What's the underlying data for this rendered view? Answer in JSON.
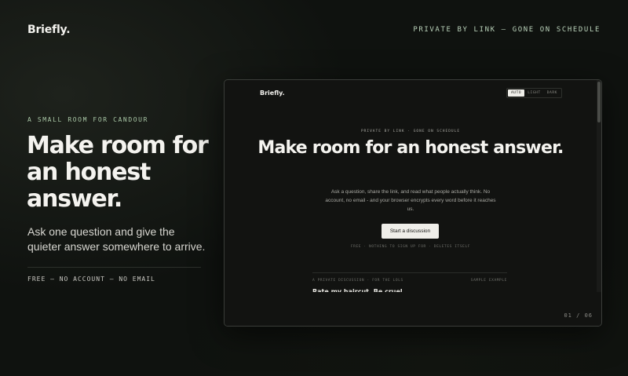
{
  "header": {
    "brand": "Briefly.",
    "tagline": "PRIVATE BY LINK — GONE ON SCHEDULE"
  },
  "hero": {
    "eyebrow": "A SMALL ROOM FOR CANDOUR",
    "title": "Make room for an honest answer.",
    "subtitle": "Ask one question and give the quieter answer somewhere to arrive.",
    "footnote": "FREE — NO ACCOUNT — NO EMAIL"
  },
  "preview": {
    "brand": "Briefly.",
    "theme_options": [
      "AUTO",
      "LIGHT",
      "DARK"
    ],
    "theme_selected": "AUTO",
    "eyebrow": "PRIVATE BY LINK · GONE ON SCHEDULE",
    "title": "Make room for an honest answer.",
    "body": "Ask a question, share the link, and read what people actually think. No account, no email - and your browser encrypts every word before it reaches us.",
    "cta_label": "Start a discussion",
    "meta": "FREE · NOTHING TO SIGN UP FOR · DELETES ITSELF",
    "sample_left": "A PRIVATE DISCUSSION · FOR THE LOLS",
    "sample_right": "SAMPLE EXAMPLE",
    "sample_question": "Rate my haircut. Be cruel."
  },
  "pager": {
    "current": "01",
    "separator": "/",
    "total": "06"
  }
}
